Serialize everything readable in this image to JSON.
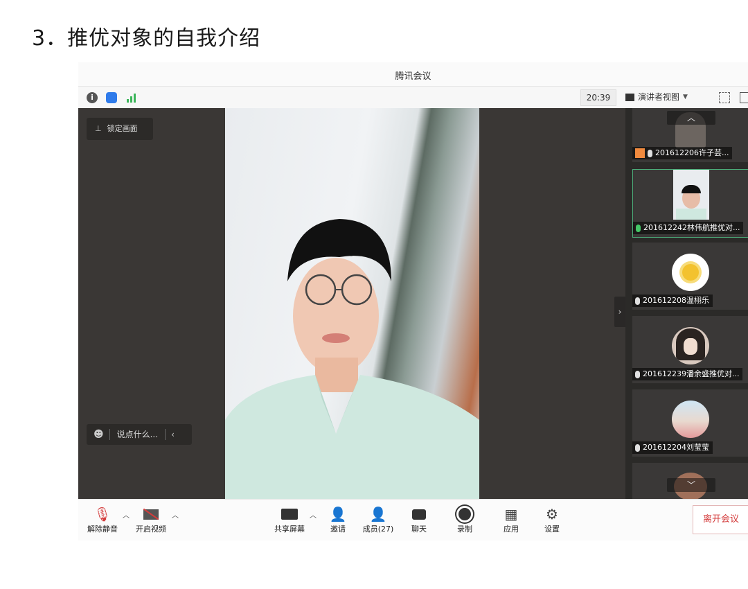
{
  "heading": "3．推优对象的自我介绍",
  "window": {
    "title": "腾讯会议",
    "clock": "20:39",
    "view_mode": "演讲者视图"
  },
  "stage": {
    "lock_label": "锁定画面",
    "chat_placeholder": "说点什么..."
  },
  "participants": [
    {
      "name": "201612206许子芸...",
      "mic": "muted"
    },
    {
      "name": "201612242林伟航推优对...",
      "mic": "active"
    },
    {
      "name": "201612208温栩乐",
      "mic": "muted"
    },
    {
      "name": "201612239潘余盛推优对...",
      "mic": "muted"
    },
    {
      "name": "201612204刘莹莹",
      "mic": "muted"
    }
  ],
  "toolbar": {
    "unmute": "解除静音",
    "start_video": "开启视频",
    "share_screen": "共享屏幕",
    "invite": "邀请",
    "members": "成员(27)",
    "chat": "聊天",
    "record": "录制",
    "apps": "应用",
    "settings": "设置",
    "leave": "离开会议"
  }
}
